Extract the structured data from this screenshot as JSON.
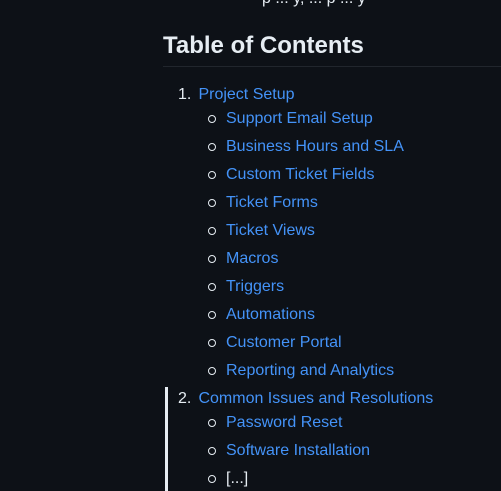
{
  "page": {
    "cut_text": "p ... y, ... p ... y",
    "heading": "Table of Contents"
  },
  "toc": {
    "sections": [
      {
        "number": "1.",
        "label": "Project Setup",
        "items": [
          "Support Email Setup",
          "Business Hours and SLA",
          "Custom Ticket Fields",
          "Ticket Forms",
          "Ticket Views",
          "Macros",
          "Triggers",
          "Automations",
          "Customer Portal",
          "Reporting and Analytics"
        ]
      },
      {
        "number": "2.",
        "label": "Common Issues and Resolutions",
        "items": [
          "Password Reset",
          "Software Installation",
          "[...]"
        ]
      }
    ]
  },
  "colors": {
    "background": "#0d1117",
    "text": "#e6edf3",
    "link": "#4493f8",
    "rule": "#21262d"
  }
}
